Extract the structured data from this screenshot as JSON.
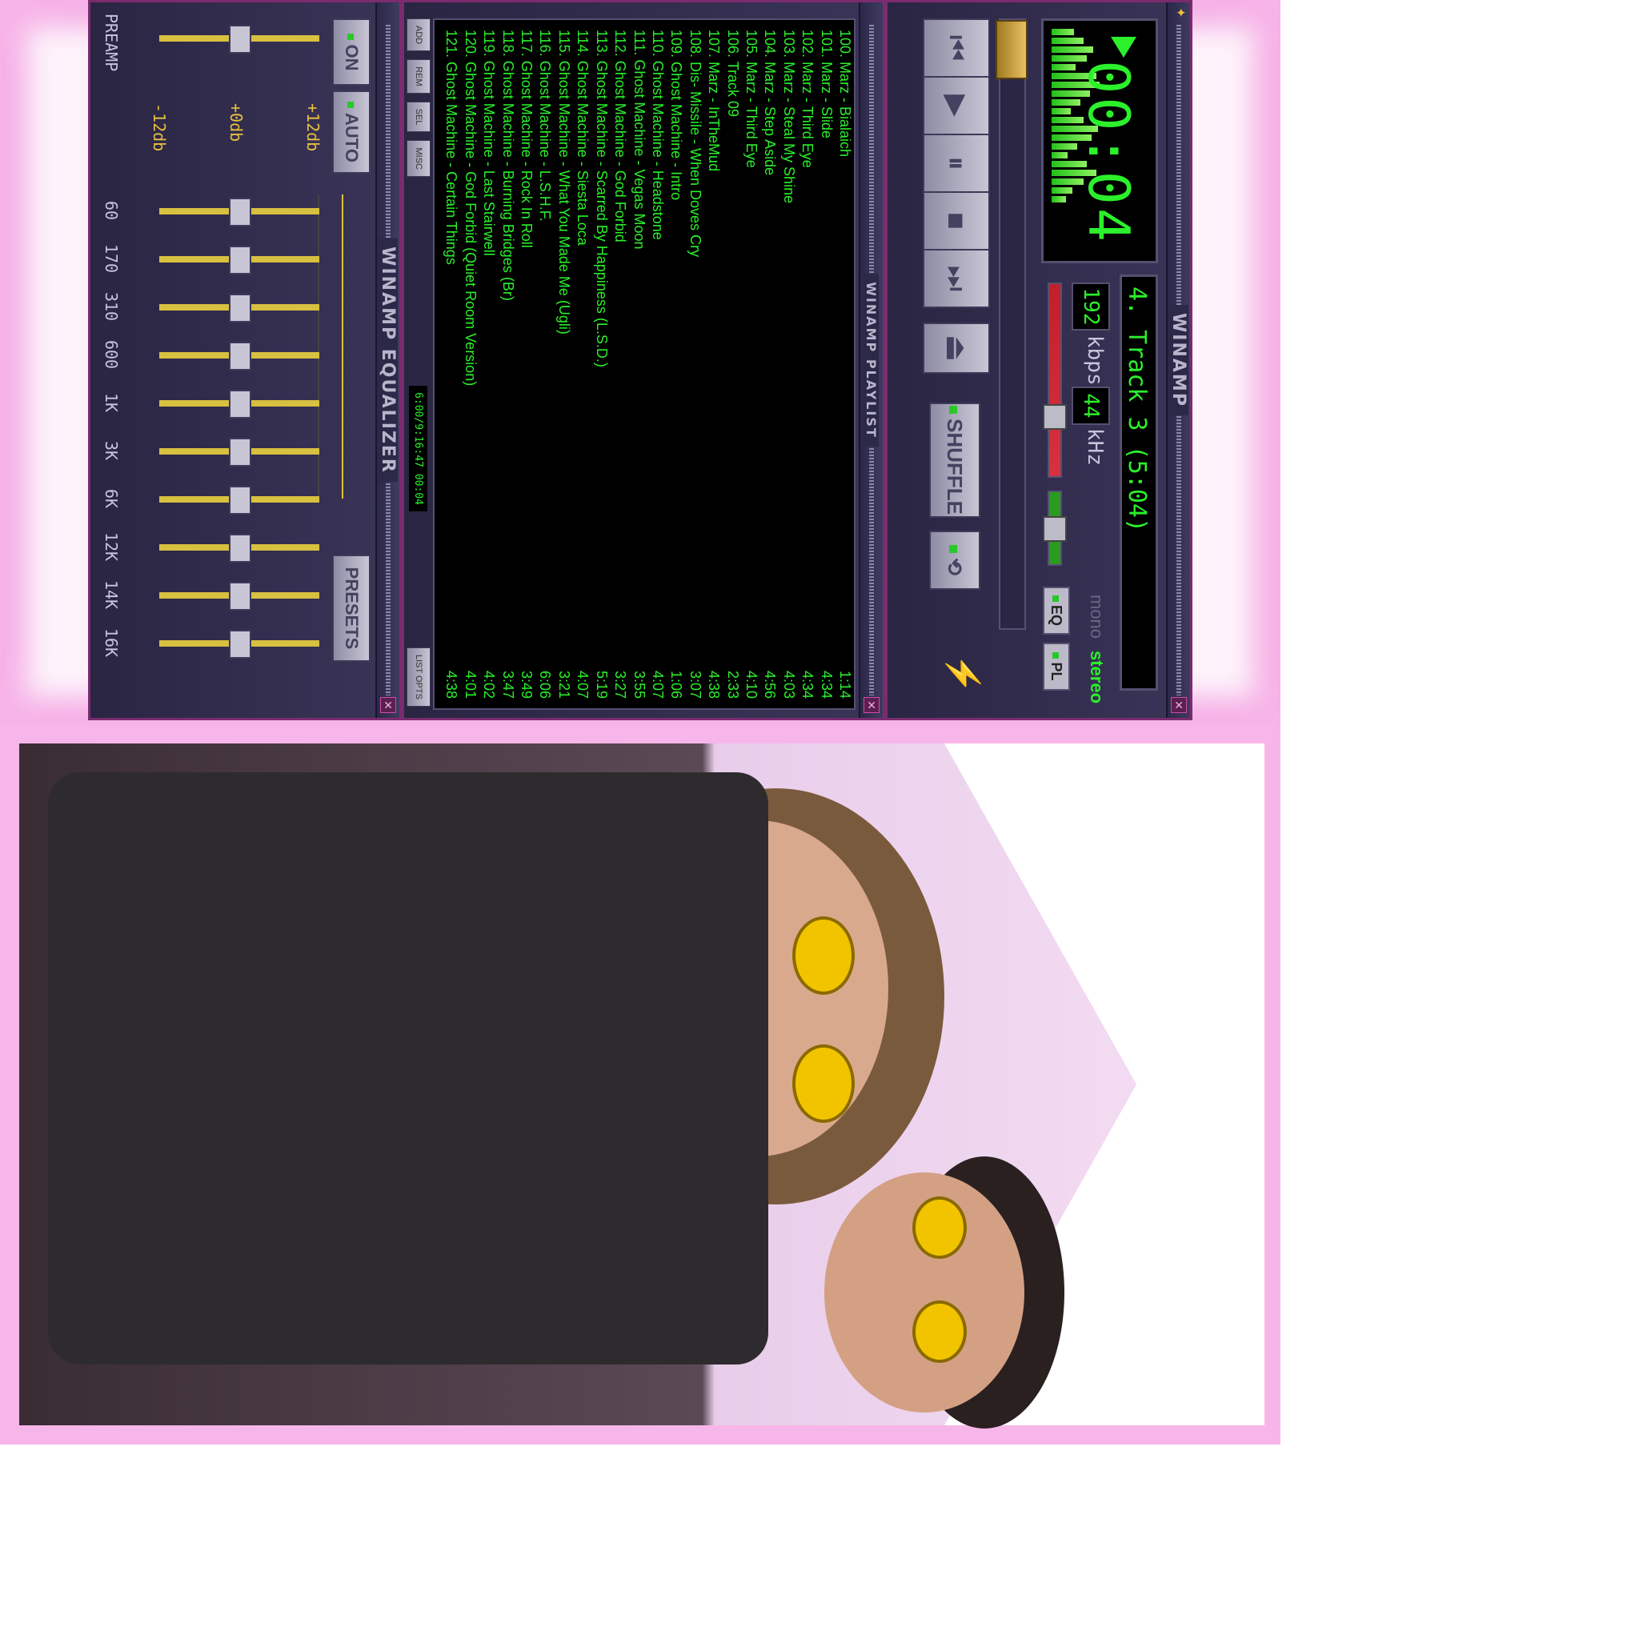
{
  "player": {
    "title": "WINAMP",
    "time": "00:04",
    "song": "4. Track 3 (5:04)",
    "kbps": "192",
    "kbps_unit": "kbps",
    "khz": "44",
    "khz_unit": "kHz",
    "mono": "mono",
    "stereo": "stereo",
    "eq_toggle": "EQ",
    "pl_toggle": "PL",
    "shuffle": "SHUFFLE",
    "spectrum": [
      28,
      40,
      52,
      44,
      30,
      56,
      60,
      48,
      36,
      24,
      40,
      58,
      50,
      32,
      20,
      44,
      56,
      40,
      26,
      18
    ]
  },
  "playlist": {
    "title": "WINAMP PLAYLIST",
    "rows": [
      {
        "name": "100. Marz - Bialaich",
        "len": "1:14"
      },
      {
        "name": "101. Marz - Slide",
        "len": "4:34"
      },
      {
        "name": "102. Marz - Third Eye",
        "len": "4:34"
      },
      {
        "name": "103. Marz - Steal My Shine",
        "len": "4:03"
      },
      {
        "name": "104. Marz - Step Aside",
        "len": "4:56"
      },
      {
        "name": "105. Marz - Third Eye",
        "len": "4:10"
      },
      {
        "name": "106. Track 09",
        "len": "2:33"
      },
      {
        "name": "107. Marz - InTheMud",
        "len": "4:38"
      },
      {
        "name": "108. Dis- Missile - When Doves Cry",
        "len": "3:07"
      },
      {
        "name": "109. Ghost Machine - Intro",
        "len": "1:06"
      },
      {
        "name": "110. Ghost Machine - Headstone",
        "len": "4:07"
      },
      {
        "name": "111. Ghost Machine - Vegas Moon",
        "len": "3:55"
      },
      {
        "name": "112. Ghost Machine - God Forbid",
        "len": "3:27"
      },
      {
        "name": "113. Ghost Machine - Scarred By Happiness (L.S.D.)",
        "len": "5:19"
      },
      {
        "name": "114. Ghost Machine - Siesta Loca",
        "len": "4:07"
      },
      {
        "name": "115. Ghost Machine - What You Made Me (Ugli)",
        "len": "3:21"
      },
      {
        "name": "116. Ghost Machine - L.S.H.F.",
        "len": "6:06"
      },
      {
        "name": "117. Ghost Machine - Rock In Roll",
        "len": "3:49"
      },
      {
        "name": "118. Ghost Machine - Burning Bridges (Br)",
        "len": "3:47"
      },
      {
        "name": "119. Ghost Machine - Last Stairwell",
        "len": "4:02"
      },
      {
        "name": "120. Ghost Machine - God Forbid (Quiet Room Version)",
        "len": "4:01"
      },
      {
        "name": "121. Ghost Machine - Certain Things",
        "len": "4:38"
      }
    ],
    "buttons": [
      "ADD",
      "REM",
      "SEL",
      "MISC"
    ],
    "list_opts": "LIST OPTS",
    "info_time": "6:00/9:16:47",
    "info_counter": "00:04"
  },
  "equalizer": {
    "title": "WINAMP EQUALIZER",
    "on": "ON",
    "auto": "AUTO",
    "presets": "PRESETS",
    "db_top": "+12db",
    "db_mid": "+0db",
    "db_bot": "-12db",
    "preamp": "PREAMP",
    "bands": [
      "60",
      "170",
      "310",
      "600",
      "1K",
      "3K",
      "6K",
      "12K",
      "14K",
      "16K"
    ]
  }
}
